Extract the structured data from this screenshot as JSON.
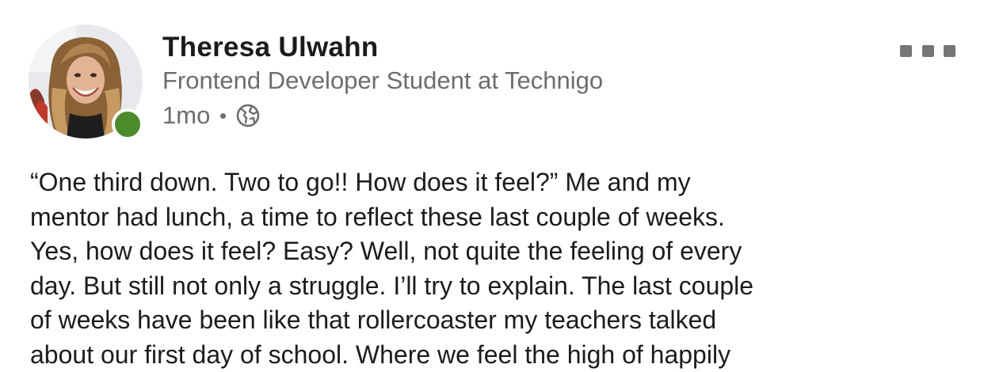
{
  "author": {
    "name": "Theresa Ulwahn",
    "headline": "Frontend Developer Student at Technigo",
    "online_status_color": "#4b8b2b"
  },
  "meta": {
    "time_ago": "1mo",
    "visibility_icon": "globe-icon"
  },
  "menu": {
    "more_icon": "more-options-icon"
  },
  "post": {
    "lines": [
      "“One third down. Two to go!! How does it feel?” Me and my",
      "mentor had lunch, a time to reflect these last couple of weeks.",
      "Yes, how does it feel? Easy? Well, not quite the feeling of every",
      "day. But still not only a struggle. I’ll try to explain. The last couple",
      "of weeks have been like that rollercoaster my teachers talked",
      "about our first day of school. Where we feel the high of happily"
    ]
  }
}
